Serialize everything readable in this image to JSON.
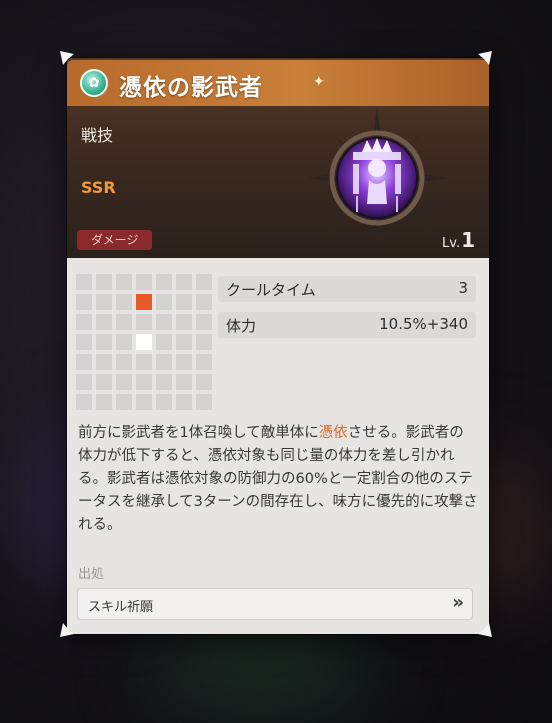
{
  "skill": {
    "title": "憑依の影武者",
    "category": "戦技",
    "rarity": "SSR",
    "tag": "ダメージ",
    "level_prefix": "Lv.",
    "level_value": "1"
  },
  "stats": [
    {
      "label": "クールタイム",
      "value": "3"
    },
    {
      "label": "体力",
      "value": "10.5%+340"
    }
  ],
  "range_grid": {
    "rows": 7,
    "cols": 7,
    "target": [
      1,
      3
    ],
    "self": [
      3,
      3
    ]
  },
  "description": {
    "before": "前方に影武者を1体召喚して敵単体に",
    "highlight": "憑依",
    "after": "させる。影武者の体力が低下すると、憑依対象も同じ量の体力を差し引かれる。影武者は憑依対象の防御力の60%と一定割合の他のステータスを継承して3ターンの間存在し、味方に優先的に攻撃される。"
  },
  "source": {
    "label": "出処",
    "button": "スキル祈願",
    "chevron": "»"
  },
  "colors": {
    "accent": "#c9803a",
    "rarity": "#f29a3a",
    "tag_bg": "#8a2a2c",
    "highlight": "#e06a2c",
    "target_cell": "#e85a2a"
  },
  "icons": {
    "rank": "rank-badge-icon",
    "emblem": "skill-emblem-icon",
    "chevron": "double-chevron-right-icon"
  }
}
